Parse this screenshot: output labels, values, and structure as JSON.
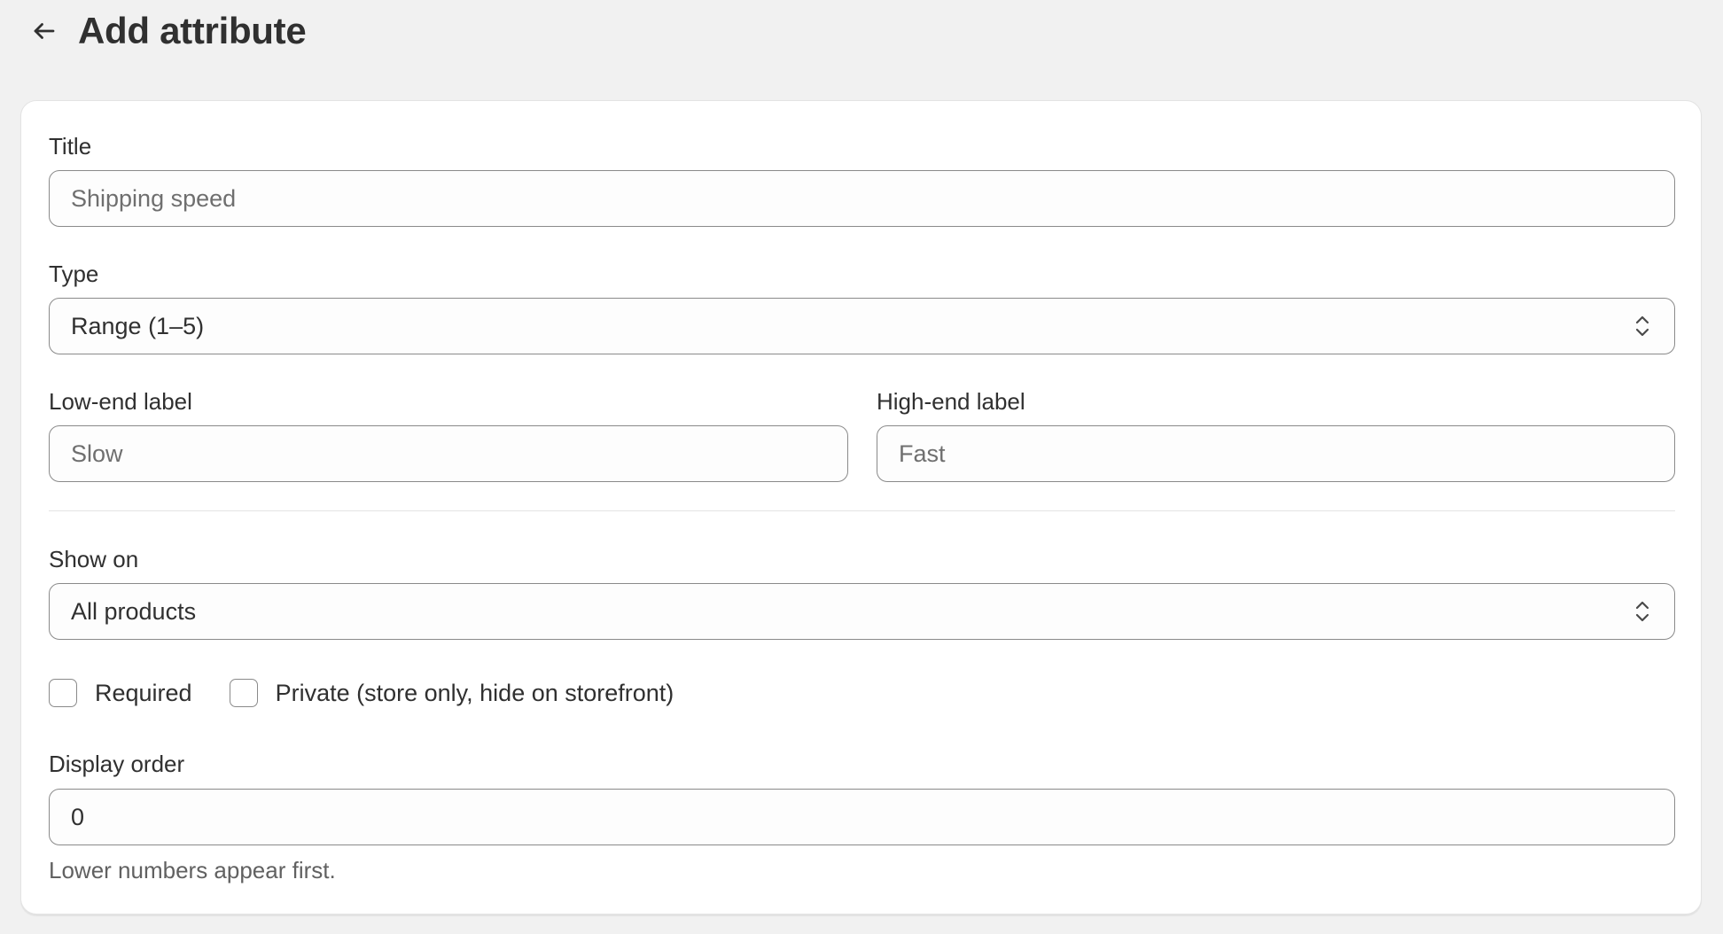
{
  "header": {
    "title": "Add attribute",
    "back_icon": "arrow-left-icon"
  },
  "form": {
    "title_field": {
      "label": "Title",
      "placeholder": "Shipping speed",
      "value": ""
    },
    "type_field": {
      "label": "Type",
      "value": "Range (1–5)",
      "icon": "select-chevrons-icon"
    },
    "low_end_field": {
      "label": "Low-end label",
      "placeholder": "Slow",
      "value": ""
    },
    "high_end_field": {
      "label": "High-end label",
      "placeholder": "Fast",
      "value": ""
    },
    "show_on_field": {
      "label": "Show on",
      "value": "All products",
      "icon": "select-chevrons-icon"
    },
    "checkboxes": {
      "required": {
        "label": "Required",
        "checked": false
      },
      "private": {
        "label": "Private (store only, hide on storefront)",
        "checked": false
      }
    },
    "display_order_field": {
      "label": "Display order",
      "value": "0",
      "help_text": "Lower numbers appear first."
    }
  },
  "colors": {
    "background": "#f1f1f1",
    "card": "#ffffff",
    "text": "#303030",
    "border": "#8a8a8a",
    "muted": "#616161"
  }
}
